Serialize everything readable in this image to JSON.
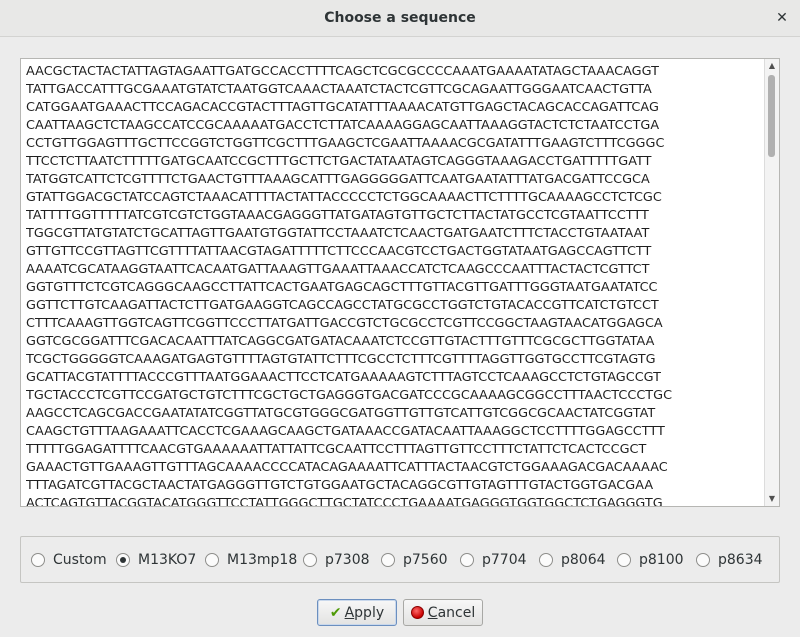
{
  "window": {
    "title": "Choose a sequence",
    "close_glyph": "✕"
  },
  "sequence": {
    "lines": [
      "AACGCTACTACTATTAGTAGAATTGATGCCACCTTTTCAGCTCGCGCCCCAAATGAAAATATAGCTAAACAGGT",
      "TATTGACCATTTGCGAAATGTATCTAATGGTCAAACTAAATCTACTCGTTCGCAGAATTGGGAATCAACTGTTA",
      "CATGGAATGAAACTTCCAGACACCGTACTTTAGTTGCATATTTAAAACATGTTGAGCTACAGCACCAGATTCAG",
      "CAATTAAGCTCTAAGCCATCCGCAAAAATGACCTCTTATCAAAAGGAGCAATTAAAGGTACTCTCTAATCCTGA",
      "CCTGTTGGAGTTTGCTTCCGGTCTGGTTCGCTTTGAAGCTCGAATTAAAACGCGATATTTGAAGTCTTTCGGGC",
      "TTCCTCTTAATCTTTTTGATGCAATCCGCTTTGCTTCTGACTATAATAGTCAGGGTAAAGACCTGATTTTTGATT",
      "TATGGTCATTCTCGTTTTCTGAACTGTTTAAAGCATTTGAGGGGGATTCAATGAATATTTATGACGATTCCGCA",
      "GTATTGGACGCTATCCAGTCTAAACATTTTACTATTACCCCCTCTGGCAAAACTTCTTTTGCAAAAGCCTCTCGC",
      "TATTTTGGTTTTTATCGTCGTCTGGTAAACGAGGGTTATGATAGTGTTGCTCTTACTATGCCTCGTAATTCCTTT",
      "TGGCGTTATGTATCTGCATTAGTTGAATGTGGTATTCCTAAATCTCAACTGATGAATCTTTCTACCTGTAATAAT",
      "GTTGTTCCGTTAGTTCGTTTTATTAACGTAGATTTTTCTTCCCAACGTCCTGACTGGTATAATGAGCCAGTTCTT",
      "AAAATCGCATAAGGTAATTCACAATGATTAAAGTTGAAATTAAACCATCTCAAGCCCAATTTACTACTCGTTCT",
      "GGTGTTTCTCGTCAGGGCAAGCCTTATTCACTGAATGAGCAGCTTTGTTACGTTGATTTGGGTAATGAATATCC",
      "GGTTCTTGTCAAGATTACTCTTGATGAAGGTCAGCCAGCCTATGCGCCTGGTCTGTACACCGTTCATCTGTCCT",
      "CTTTCAAAGTTGGTCAGTTCGGTTCCCTTATGATTGACCGTCTGCGCCTCGTTCCGGCTAAGTAACATGGAGCA",
      "GGTCGCGGATTTCGACACAATTTATCAGGCGATGATACAAATCTCCGTTGTACTTTGTTTCGCGCTTGGTATAA",
      "TCGCTGGGGGTCAAAGATGAGTGTTTTAGTGTATTCTTTCGCCTCTTTCGTTTTAGGTTGGTGCCTTCGTAGTG",
      "GCATTACGTATTTTACCCGTTTAATGGAAACTTCCTCATGAAAAAGTCTTTAGTCCTCAAAGCCTCTGTAGCCGT",
      "TGCTACCCTCGTTCCGATGCTGTCTTTCGCTGCTGAGGGTGACGATCCCGCAAAAGCGGCCTTTAACTCCCTGC",
      "AAGCCTCAGCGACCGAATATATCGGTTATGCGTGGGCGATGGTTGTTGTCATTGTCGGCGCAACTATCGGTAT",
      "CAAGCTGTTTAAGAAATTCACCTCGAAAGCAAGCTGATAAACCGATACAATTAAAGGCTCCTTTTGGAGCCTTT",
      "TTTTTGGAGATTTTCAACGTGAAAAAATTATTATTCGCAATTCCTTTAGTTGTTCCTTTCTATTCTCACTCCGCT",
      "GAAACTGTTGAAAGTTGTTTAGCAAAACCCCATACAGAAAATTCATTTACTAACGTCTGGAAAGACGACAAAAC",
      "TTTAGATCGTTACGCTAACTATGAGGGTTGTCTGTGGAATGCTACAGGCGTTGTAGTTTGTACTGGTGACGAA",
      "ACTCAGTGTTACGGTACATGGGTTCCTATTGGGCTTGCTATCCCTGAAAATGAGGGTGGTGGCTCTGAGGGTG"
    ],
    "scroll_up_glyph": "▲",
    "scroll_down_glyph": "▼"
  },
  "radio_options": [
    {
      "label": "Custom",
      "checked": false
    },
    {
      "label": "M13KO7",
      "checked": true
    },
    {
      "label": "M13mp18",
      "checked": false
    },
    {
      "label": "p7308",
      "checked": false
    },
    {
      "label": "p7560",
      "checked": false
    },
    {
      "label": "p7704",
      "checked": false
    },
    {
      "label": "p8064",
      "checked": false
    },
    {
      "label": "p8100",
      "checked": false
    },
    {
      "label": "p8634",
      "checked": false
    }
  ],
  "buttons": {
    "apply_label": "Apply",
    "apply_icon": "checkmark-icon",
    "cancel_label": "Cancel",
    "cancel_icon": "stop-icon"
  },
  "colors": {
    "accent_green": "#4e9a06",
    "cancel_red": "#c80000"
  }
}
